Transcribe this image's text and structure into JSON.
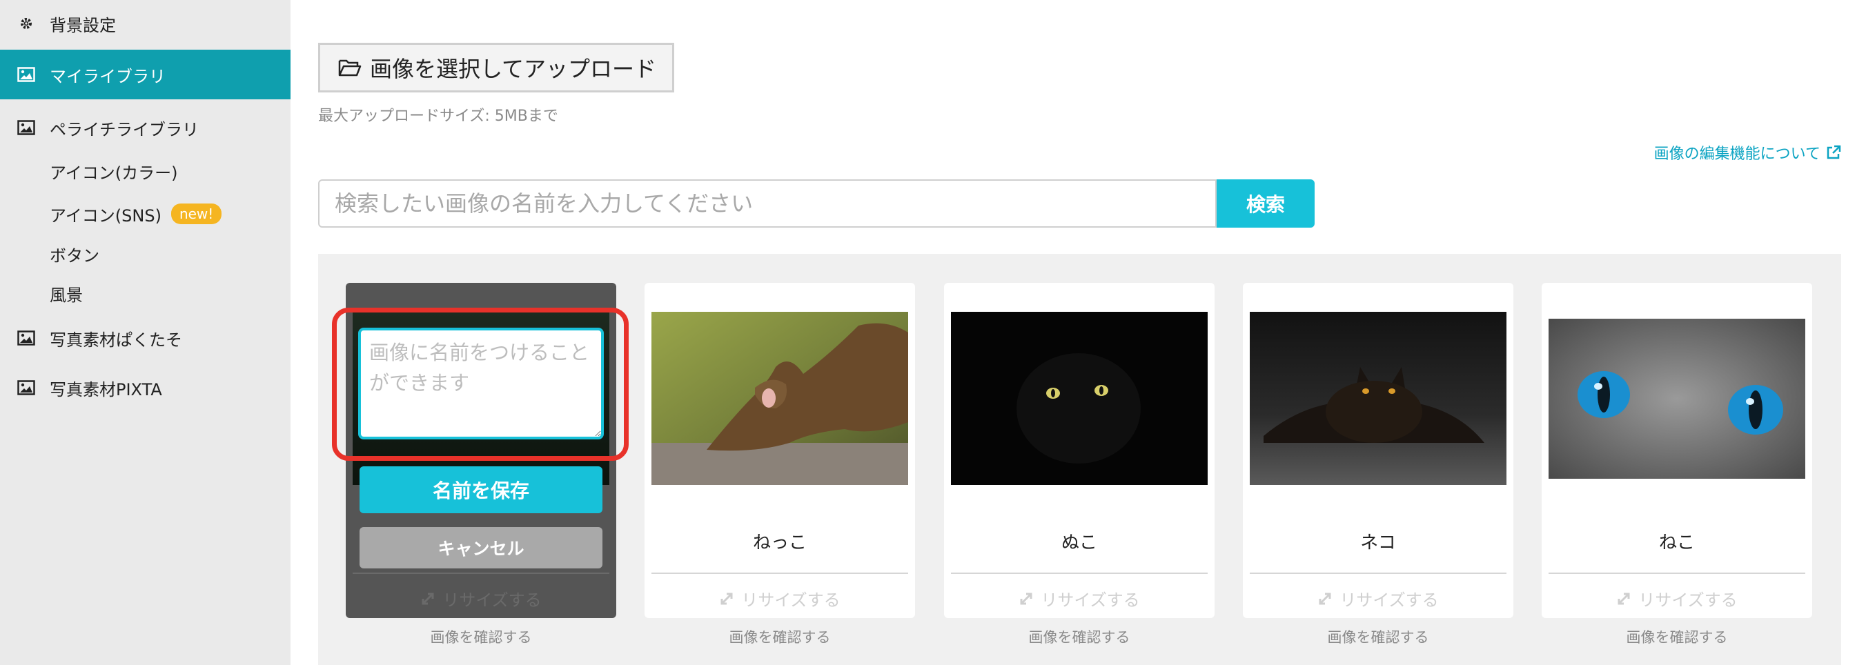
{
  "sidebar": {
    "background_settings": "背景設定",
    "my_library": "マイライブラリ",
    "peraichi_library": "ペライチライブラリ",
    "sub_items": [
      {
        "label": "アイコン(カラー)",
        "badge": ""
      },
      {
        "label": "アイコン(SNS)",
        "badge": "new!"
      },
      {
        "label": "ボタン",
        "badge": ""
      },
      {
        "label": "風景",
        "badge": ""
      }
    ],
    "photo_pakutaso": "写真素材ぱくたそ",
    "photo_pixta": "写真素材PIXTA"
  },
  "main": {
    "upload_button": "画像を選択してアップロード",
    "upload_note": "最大アップロードサイズ: 5MBまで",
    "edit_link": "画像の編集機能について",
    "search": {
      "placeholder": "検索したい画像の名前を入力してください",
      "button": "検索"
    },
    "editing_card": {
      "name_placeholder": "画像に名前をつけることができます",
      "save": "名前を保存",
      "cancel": "キャンセル",
      "resize": "リサイズする",
      "confirm": "画像を確認する"
    },
    "cards": [
      {
        "title": "ねっこ",
        "resize": "リサイズする",
        "confirm": "画像を確認する"
      },
      {
        "title": "ぬこ",
        "resize": "リサイズする",
        "confirm": "画像を確認する"
      },
      {
        "title": "ネコ",
        "resize": "リサイズする",
        "confirm": "画像を確認する"
      },
      {
        "title": "ねこ",
        "resize": "リサイズする",
        "confirm": "画像を確認する"
      }
    ]
  },
  "colors": {
    "accent": "#17c1d9",
    "sidebar_active": "#0f9fae",
    "highlight": "#e8322a",
    "badge": "#f5b521"
  }
}
